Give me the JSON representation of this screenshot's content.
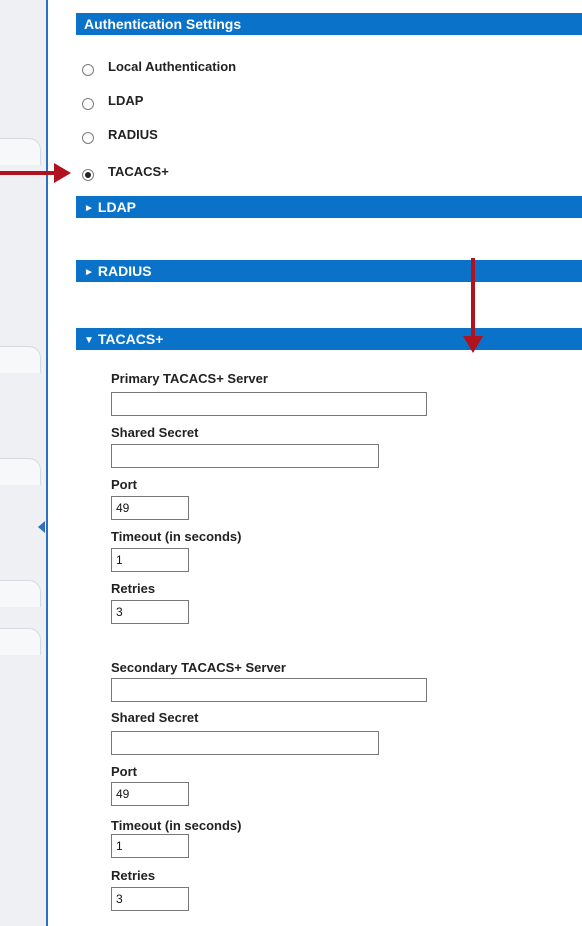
{
  "auth_bar": {
    "title": "Authentication Settings"
  },
  "options": [
    {
      "label": "Local Authentication",
      "selected": false
    },
    {
      "label": "LDAP",
      "selected": false
    },
    {
      "label": "RADIUS",
      "selected": false
    },
    {
      "label": "TACACS+",
      "selected": true
    }
  ],
  "sections": {
    "ldap": {
      "title": "LDAP",
      "state": "collapsed"
    },
    "radius": {
      "title": "RADIUS",
      "state": "collapsed"
    },
    "tacacs": {
      "title": "TACACS+",
      "state": "expanded"
    }
  },
  "primary": {
    "server_label": "Primary TACACS+ Server",
    "server_value": "",
    "secret_label": "Shared Secret",
    "secret_value": "",
    "port_label": "Port",
    "port_value": "49",
    "timeout_label": "Timeout (in seconds)",
    "timeout_value": "1",
    "retries_label": "Retries",
    "retries_value": "3"
  },
  "secondary": {
    "server_label": "Secondary TACACS+ Server",
    "server_value": "",
    "secret_label": "Shared Secret",
    "secret_value": "",
    "port_label": "Port",
    "port_value": "49",
    "timeout_label": "Timeout (in seconds)",
    "timeout_value": "1",
    "retries_label": "Retries",
    "retries_value": "3"
  },
  "colors": {
    "bar": "#0a73c9",
    "arrow": "#b0131e",
    "rail_border": "#2f6fbf"
  }
}
